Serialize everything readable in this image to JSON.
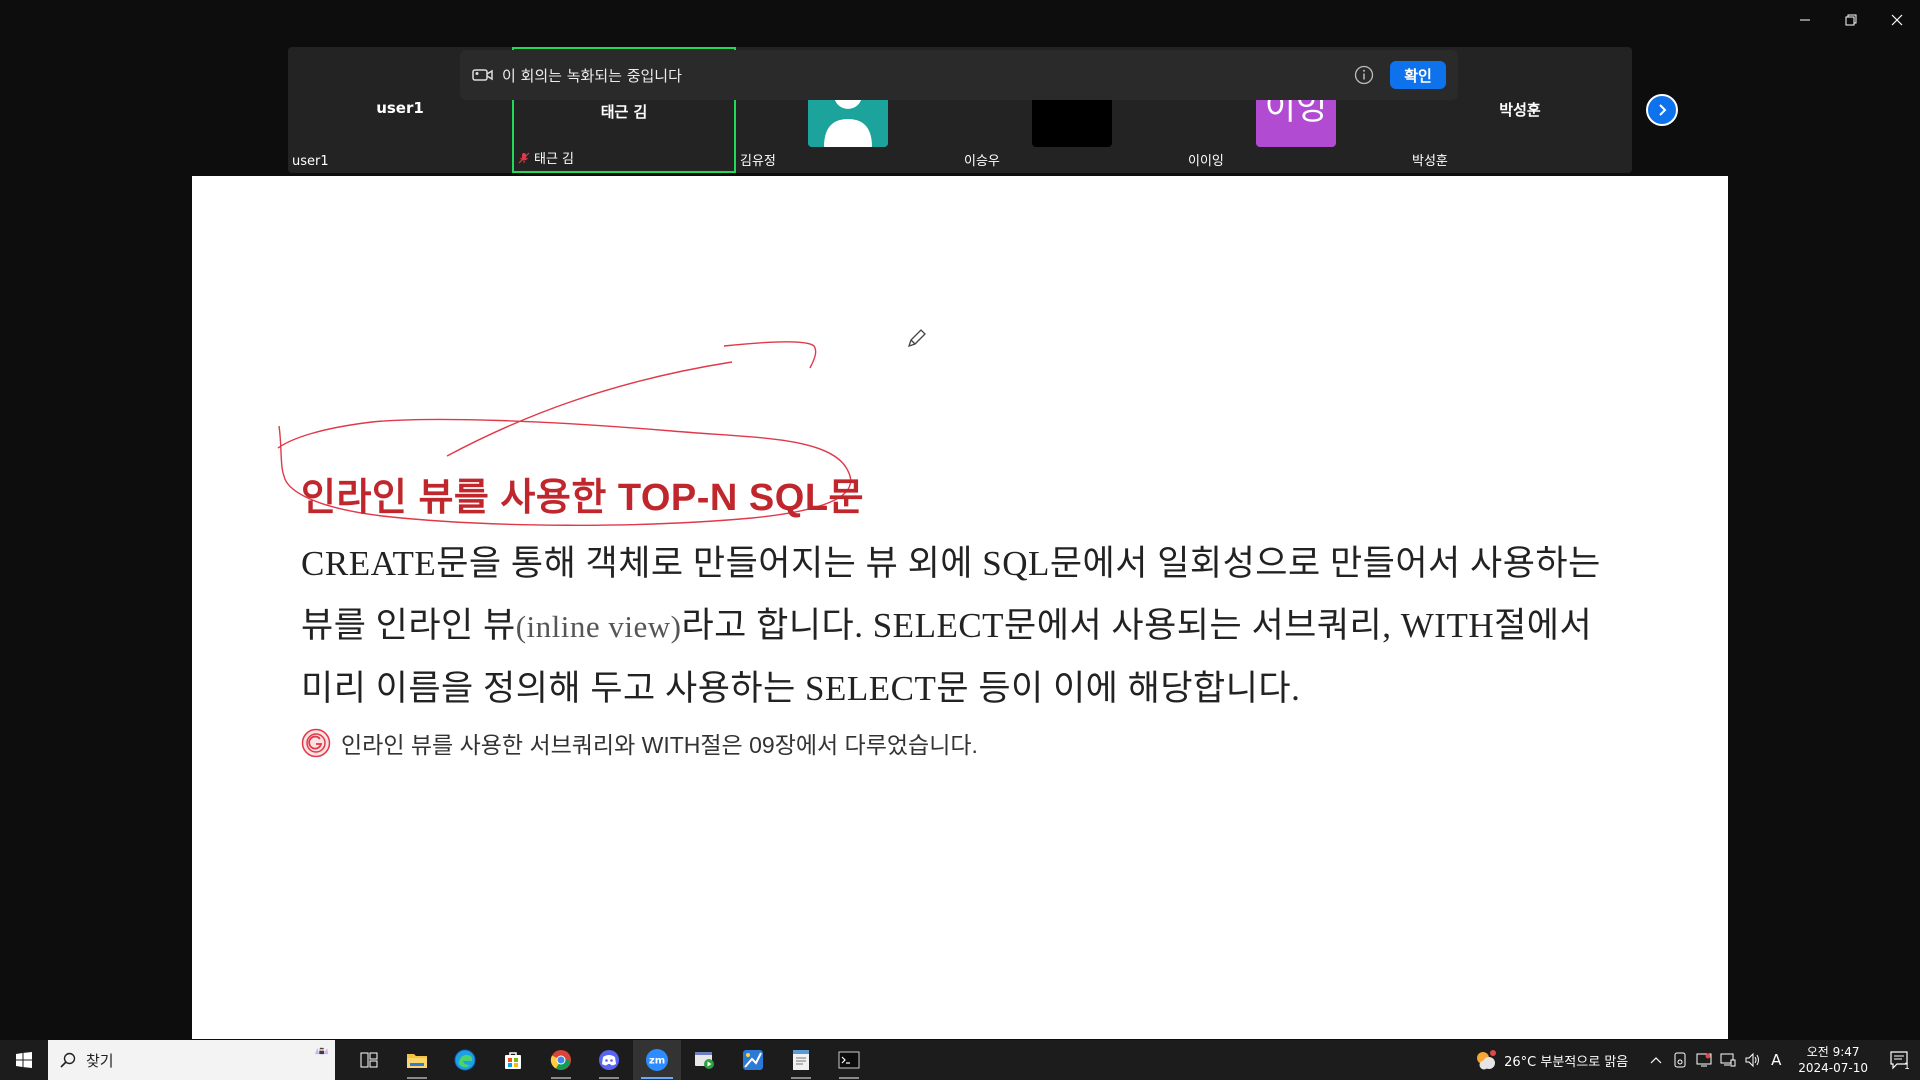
{
  "window": {
    "minimize": "minimize",
    "restore": "restore",
    "close": "close"
  },
  "recording_notice": {
    "text": "이 회의는 녹화되는 중입니다",
    "confirm_label": "확인"
  },
  "participants": [
    {
      "top_label": "user1",
      "bottom_label": "user1"
    },
    {
      "top_label": "태근 김",
      "bottom_label": "태근 김",
      "muted": true,
      "active_speaker": true
    },
    {
      "top_label": "",
      "bottom_label": "김유정",
      "avatar_color": "#1ba39c"
    },
    {
      "top_label": "",
      "bottom_label": "이승우",
      "avatar_color": "#000000"
    },
    {
      "top_label": "",
      "bottom_label": "이이잉",
      "avatar_text": "이잉",
      "avatar_color": "#b14bd1"
    },
    {
      "top_label": "박성훈",
      "bottom_label": "박성훈"
    }
  ],
  "slide": {
    "title": "인라인 뷰를 사용한 TOP-N SQL문",
    "body_line1": "CREATE문을 통해 객체로 만들어지는 뷰 외에 SQL문에서 일회성으로 만들어서 사용하는",
    "body_line2a": "뷰를 인라인 뷰",
    "body_line2b": "(inline view)",
    "body_line2c": "라고 합니다. SELECT문에서 사용되는 서브쿼리, WITH절에서",
    "body_line3": "미리 이름을 정의해 두고 사용하는 SELECT문 등이 이에 해당합니다.",
    "note": "인라인 뷰를 사용한 서브쿼리와 WITH절은 09장에서 다루었습니다.",
    "annotation_color": "#e0394a"
  },
  "taskbar": {
    "search_label": "찾기",
    "apps": [
      "task-view",
      "file-explorer",
      "edge",
      "microsoft-store",
      "chrome",
      "discord",
      "zoom",
      "media-app",
      "photo-editor",
      "notepad-app",
      "terminal"
    ],
    "weather": "26°C  부분적으로 맑음",
    "time": "오전 9:47",
    "date": "2024-07-10",
    "ime": "A",
    "notification_count": "1"
  }
}
